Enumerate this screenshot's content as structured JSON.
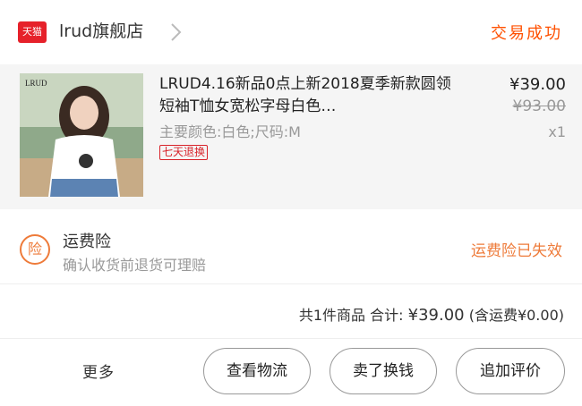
{
  "shop": {
    "logo_text": "天猫",
    "name": "lrud旗舰店",
    "status": "交易成功"
  },
  "item": {
    "image_label": "LRUD",
    "title": "LRUD4.16新品0点上新2018夏季新款圆领短袖T恤女宽松字母白色…",
    "sku": "主要颜色:白色;尺码:M",
    "return_tag": "七天退换",
    "price": "¥39.00",
    "original_price": "¥93.00",
    "quantity": "x1"
  },
  "insurance": {
    "icon_text": "险",
    "title": "运费险",
    "description": "确认收货前退货可理赔",
    "status": "运费险已失效"
  },
  "summary": {
    "count_text": "共1件商品",
    "total_label": "合计:",
    "total_amount": "¥39.00",
    "shipping_note": "(含运费¥0.00)"
  },
  "actions": {
    "more": "更多",
    "logistics": "查看物流",
    "sell": "卖了换钱",
    "review": "追加评价"
  }
}
